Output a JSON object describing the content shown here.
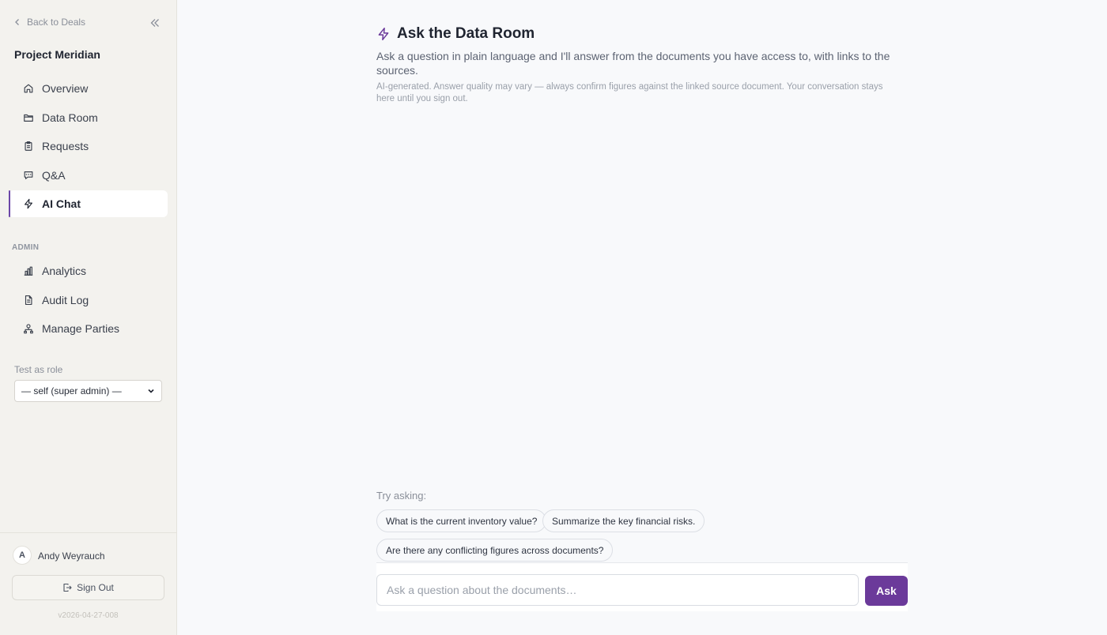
{
  "sidebar": {
    "back_label": "Back to Deals",
    "project_name": "Project Meridian",
    "nav_items": [
      {
        "label": "Overview",
        "icon": "home-icon"
      },
      {
        "label": "Data Room",
        "icon": "folder-icon"
      },
      {
        "label": "Requests",
        "icon": "clipboard-icon"
      },
      {
        "label": "Q&A",
        "icon": "message-icon"
      },
      {
        "label": "AI Chat",
        "icon": "lightning-icon",
        "active": true
      }
    ],
    "admin_label": "ADMIN",
    "admin_items": [
      {
        "label": "Analytics",
        "icon": "bar-chart-icon"
      },
      {
        "label": "Audit Log",
        "icon": "document-icon"
      },
      {
        "label": "Manage Parties",
        "icon": "parties-icon"
      }
    ],
    "role_label": "Test as role",
    "role_selected": "— self (super admin) —",
    "user": {
      "initial": "A",
      "name": "Andy Weyrauch"
    },
    "signout_label": "Sign Out",
    "version": "v2026-04-27-008"
  },
  "main": {
    "title": "Ask the Data Room",
    "subtitle": "Ask a question in plain language and I'll answer from the documents you have access to, with links to the sources.",
    "disclaimer": "AI-generated. Answer quality may vary — always confirm figures against the linked source document. Your conversation stays here until you sign out.",
    "try_label": "Try asking:",
    "suggestions": [
      "What is the current inventory value?",
      "Summarize the key financial risks.",
      "Are there any conflicting figures across documents?"
    ],
    "input_placeholder": "Ask a question about the documents…",
    "ask_label": "Ask"
  },
  "colors": {
    "accent": "#6b3a9a",
    "active_bar": "#6b46a8",
    "sidebar_bg": "#f3f2ee",
    "main_bg": "#f8f9fb"
  }
}
